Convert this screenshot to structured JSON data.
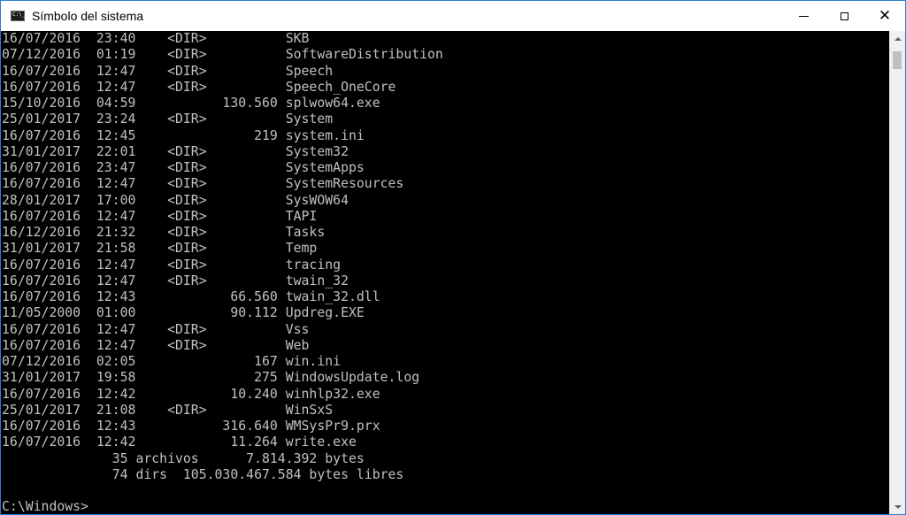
{
  "window": {
    "title": "Símbolo del sistema",
    "icon": "cmd-icon",
    "controls": {
      "minimize_icon": "minimize-icon",
      "maximize_icon": "maximize-icon",
      "close_icon": "close-icon"
    }
  },
  "console": {
    "lines": [
      "16/07/2016  23:40    <DIR>          SKB",
      "07/12/2016  01:19    <DIR>          SoftwareDistribution",
      "16/07/2016  12:47    <DIR>          Speech",
      "16/07/2016  12:47    <DIR>          Speech_OneCore",
      "15/10/2016  04:59           130.560 splwow64.exe",
      "25/01/2017  23:24    <DIR>          System",
      "16/07/2016  12:45               219 system.ini",
      "31/01/2017  22:01    <DIR>          System32",
      "16/07/2016  23:47    <DIR>          SystemApps",
      "16/07/2016  12:47    <DIR>          SystemResources",
      "28/01/2017  17:00    <DIR>          SysWOW64",
      "16/07/2016  12:47    <DIR>          TAPI",
      "16/12/2016  21:32    <DIR>          Tasks",
      "31/01/2017  21:58    <DIR>          Temp",
      "16/07/2016  12:47    <DIR>          tracing",
      "16/07/2016  12:47    <DIR>          twain_32",
      "16/07/2016  12:43            66.560 twain_32.dll",
      "11/05/2000  01:00            90.112 Updreg.EXE",
      "16/07/2016  12:47    <DIR>          Vss",
      "16/07/2016  12:47    <DIR>          Web",
      "07/12/2016  02:05               167 win.ini",
      "31/01/2017  19:58               275 WindowsUpdate.log",
      "16/07/2016  12:42            10.240 winhlp32.exe",
      "25/01/2017  21:08    <DIR>          WinSxS",
      "16/07/2016  12:43           316.640 WMSysPr9.prx",
      "16/07/2016  12:42            11.264 write.exe",
      "              35 archivos      7.814.392 bytes",
      "              74 dirs  105.030.467.584 bytes libres",
      "",
      "C:\\Windows>"
    ]
  },
  "colors": {
    "console_background": "#000000",
    "console_text": "#c0c0c0",
    "titlebar_background": "#ffffff",
    "window_border": "#2b7bd1"
  }
}
